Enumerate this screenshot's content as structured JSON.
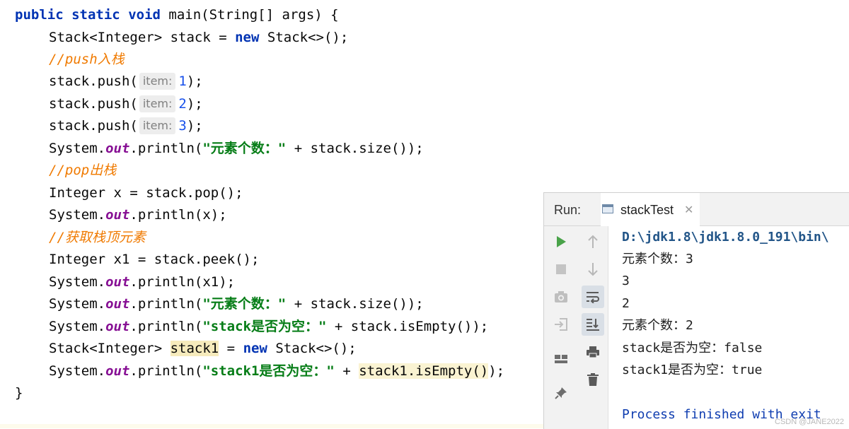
{
  "editor": {
    "method_signature": {
      "kw1": "public",
      "kw2": "static",
      "kw3": "void",
      "rest": " main(String[] args) {"
    },
    "decl_stack": {
      "pre": "Stack<Integer> stack = ",
      "kw": "new",
      "post": " Stack<>();"
    },
    "comment_push": "//push入栈",
    "push_lines": [
      {
        "pre": "stack.push(",
        "hint": "item:",
        "num": "1",
        "post": ");"
      },
      {
        "pre": "stack.push(",
        "hint": "item:",
        "num": "2",
        "post": ");"
      },
      {
        "pre": "stack.push(",
        "hint": "item:",
        "num": "3",
        "post": ");"
      }
    ],
    "print_size_1": {
      "pre": "System.",
      "field": "out",
      "mid": ".println(",
      "str": "\"元素个数：\"",
      "post": " + stack.size());"
    },
    "comment_pop": "//pop出栈",
    "pop_line": "Integer x = stack.pop();",
    "print_x": {
      "pre": "System.",
      "field": "out",
      "post": ".println(x);"
    },
    "comment_peek": "//获取栈顶元素",
    "peek_line": "Integer x1 = stack.peek();",
    "print_x1": {
      "pre": "System.",
      "field": "out",
      "post": ".println(x1);"
    },
    "print_size_2": {
      "pre": "System.",
      "field": "out",
      "mid": ".println(",
      "str": "\"元素个数：\"",
      "post": " + stack.size());"
    },
    "print_empty": {
      "pre": "System.",
      "field": "out",
      "mid": ".println(",
      "str": "\"stack是否为空：\"",
      "post": " + stack.isEmpty());"
    },
    "decl_stack1": {
      "pre": "Stack<Integer> ",
      "var": "stack1",
      "mid": " = ",
      "kw": "new",
      "post": " Stack<>();"
    },
    "print_empty1": {
      "pre": "System.",
      "field": "out",
      "mid": ".println(",
      "str": "\"stack1是否为空：\"",
      "mid2": " + ",
      "call": "stack1.isEmpty()",
      "post": ");"
    },
    "closing_brace": "}"
  },
  "run_panel": {
    "label": "Run:",
    "tab_label": "stackTest",
    "tab_close": "✕",
    "left_toolbar": [
      "run-icon",
      "stop-icon",
      "camera-icon",
      "login-icon",
      "layout-icon",
      "pin-icon"
    ],
    "right_toolbar": [
      "up-arrow-icon",
      "down-arrow-icon",
      "soft-wrap-icon",
      "scroll-to-end-icon",
      "print-icon",
      "trash-icon"
    ],
    "console_lines": [
      "D:\\jdk1.8\\jdk1.8.0_191\\bin\\",
      "元素个数：3",
      "3",
      "2",
      "元素个数：2",
      "stack是否为空：false",
      "stack1是否为空：true",
      "",
      "Process finished with exit"
    ],
    "watermark": "CSDN @JANE2022"
  },
  "colors": {
    "keyword": "#0033b3",
    "comment": "#f07a00",
    "string": "#067d17",
    "field": "#871094",
    "number": "#1750eb",
    "run_green": "#4aa34a"
  }
}
